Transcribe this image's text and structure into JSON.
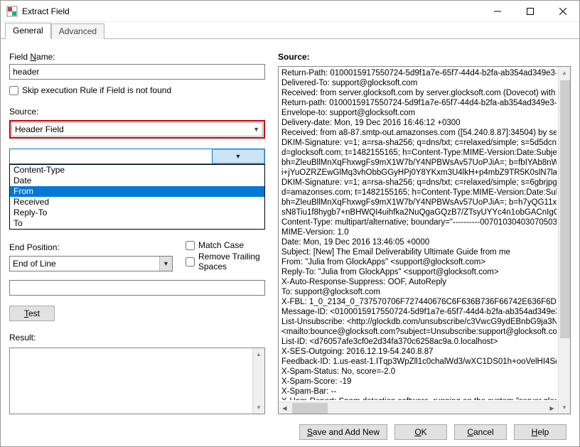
{
  "window": {
    "title": "Extract Field"
  },
  "tabs": {
    "general": "General",
    "advanced": "Advanced"
  },
  "left": {
    "field_name_label": "Field Name:",
    "field_name_value": "header",
    "skip_rule_label": "Skip execution Rule if Field is not found",
    "skip_rule_checked": false,
    "source_label": "Source:",
    "source_value": "Header Field",
    "dropdown_options": [
      "Content-Type",
      "Date",
      "From",
      "Received",
      "Reply-To",
      "To"
    ],
    "dropdown_selected": "From",
    "end_position_label": "End Position:",
    "end_position_value": "End of Line",
    "match_case_label": "Match Case",
    "match_case_checked": false,
    "remove_trailing_label": "Remove Trailing Spaces",
    "remove_trailing_checked": false,
    "extra_value": "",
    "test_label": "Test",
    "result_label": "Result:",
    "result_value": ""
  },
  "right": {
    "source_label": "Source:",
    "source_text": "Return-Path: 0100015917550724-5d9f1a7e-65f7-44d4-b2fa-ab354ad349e3-0000\nDelivered-To: support@glocksoft.com\nReceived: from server.glocksoft.com by server.glocksoft.com (Dovecot) with LMT\nReturn-path: 0100015917550724-5d9f1a7e-65f7-44d4-b2fa-ab354ad349e3-0000\nEnvelope-to: support@glocksoft.com\nDelivery-date: Mon, 19 Dec 2016 16:46:12 +0300\nReceived: from a8-87.smtp-out.amazonses.com ([54.240.8.87]:34504) by server.g\nDKIM-Signature: v=1; a=rsa-sha256; q=dns/txt; c=relaxed/simple; s=5d5dcnmxgp\nd=glocksoft.com; t=1482155165; h=Content-Type:MIME-Version:Date:Subject:Fr\nbh=ZleuBllMnXqFhxwgFs9mX1W7b/Y4NPBWsAv57UoPJiA=; b=fbIYAb8nWqRi\ni+jYuOZRZEwGlMq3vhObbGGyHPj0Y8YKxm3U4lkH+p4mbZ9TR5K0slN7lawda\nDKIM-Signature: v=1; a=rsa-sha256; q=dns/txt; c=relaxed/simple; s=6gbrjpgwjsk\nd=amazonses.com; t=1482155165; h=Content-Type:MIME-Version:Date:Subject:\nbh=ZleuBllMnXqFhxwgFs9mX1W7b/Y4NPBWsAv57UoPJiA=; b=h7yQG11xV4S\nsN8Tiu1f8hygb7+nBHWQI4uihfka2NuQgaGQzB7/ZTsyUYYc4n1obGACnIgQR+\nContent-Type: multipart/alternative; boundary=\"----------00701030403070503000\nMIME-Version: 1.0\nDate: Mon, 19 Dec 2016 13:46:05 +0000\nSubject: [New] The Email Deliverability Ultimate Guide from me\nFrom: \"Julia from GlockApps\" <support@glocksoft.com>\nReply-To: \"Julia from GlockApps\" <support@glocksoft.com>\nX-Auto-Response-Suppress: OOF, AutoReply\nTo: support@glocksoft.com\nX-FBL: 1_0_2134_0_737570706F727440676C6F636B736F66742E636F6D\nMessage-ID: <0100015917550724-5d9f1a7e-65f7-44d4-b2fa-ab354ad349e3-000\nList-Unsubscribe: <http://glockdb.com/unsubscribe/c3VwcG9ydEBnbG9ja3NvZn\n<mailto:bounce@glocksoft.com?subject=Unsubscribe:support@glocksoft.com:X\nList-ID: <d76057afe3cf0e2d34fa370c6258ac9a.0.localhost>\nX-SES-Outgoing: 2016.12.19-54.240.8.87\nFeedback-ID: 1.us-east-1.ITqp3WpZll1c0chalWd3/wXC1DS01h+ooVelHI4Sqs=:\nX-Spam-Status: No, score=-2.0\nX-Spam-Score: -19\nX-Spam-Bar: --\nX-Ham-Report: Spam detection software, running on the system \"server.glocksoft.\n has NOT identified this incoming email as spam.  The original message"
  },
  "footer": {
    "save_add_new": "Save and Add New",
    "ok": "OK",
    "cancel": "Cancel",
    "help": "Help"
  }
}
